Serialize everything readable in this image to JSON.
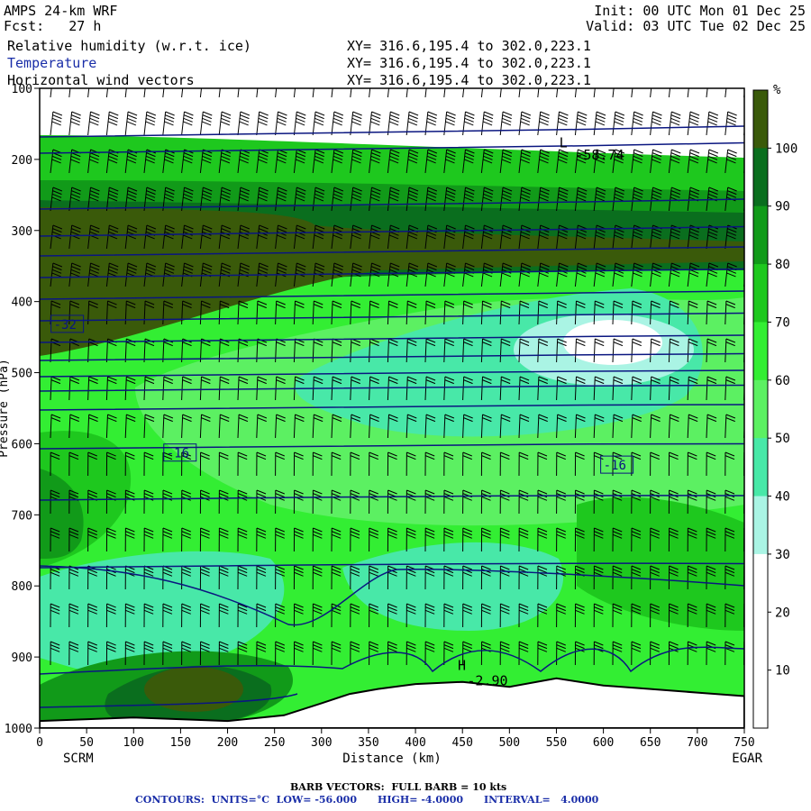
{
  "header": {
    "model": "AMPS 24-km WRF",
    "forecast": "Fcst:   27 h",
    "init": "Init: 00 UTC Mon 01 Dec 25",
    "valid": "Valid: 03 UTC Tue 02 Dec 25",
    "field1": "Relative humidity (w.r.t. ice)",
    "field2": "Temperature",
    "field3": "Horizontal wind vectors",
    "xy1": "XY= 316.6,195.4 to 302.0,223.1",
    "xy2": "XY= 316.6,195.4 to 302.0,223.1",
    "xy3": "XY= 316.6,195.4 to 302.0,223.1"
  },
  "footer": {
    "barb": "BARB VECTORS:  FULL BARB = 10 kts",
    "contours": "CONTOURS:  UNITS=°C  LOW= -56.000      HIGH= -4.0000      INTERVAL=   4.0000"
  },
  "chart_data": {
    "type": "heatmap",
    "xlabel": "Distance (km)",
    "ylabel": "Pressure (hPa)",
    "xlim": [
      0,
      750
    ],
    "ylim": [
      1000,
      100
    ],
    "x_ticks": [
      0,
      50,
      100,
      150,
      200,
      250,
      300,
      350,
      400,
      450,
      500,
      550,
      600,
      650,
      700,
      750
    ],
    "y_ticks": [
      100,
      200,
      300,
      400,
      500,
      600,
      700,
      800,
      900,
      1000
    ],
    "endpoint_labels": {
      "left": "SCRM",
      "right": "EGAR"
    },
    "colorbar": {
      "unit": "%",
      "levels": [
        100,
        90,
        80,
        70,
        60,
        50,
        40,
        30,
        20,
        10
      ],
      "colors": [
        "#3a5a0a",
        "#0a6e1e",
        "#119a19",
        "#1ec81e",
        "#33ee33",
        "#5cf062",
        "#48e8a8",
        "#aaf4e4",
        "#ffffff",
        "#ffffff",
        "#ffffff"
      ]
    },
    "temperature_contour_labels": [
      {
        "text": "-32",
        "x": 15,
        "p": 432
      },
      {
        "text": "-16",
        "x": 135,
        "p": 613
      },
      {
        "text": "-16",
        "x": 600,
        "p": 630
      }
    ],
    "annotations": [
      {
        "text": "L",
        "x": 553,
        "p": 183
      },
      {
        "text": "-58.74",
        "x": 570,
        "p": 200
      },
      {
        "text": "H",
        "x": 445,
        "p": 918
      },
      {
        "text": "-2.90",
        "x": 455,
        "p": 940
      }
    ],
    "terrain": [
      [
        0,
        990
      ],
      [
        100,
        985
      ],
      [
        200,
        990
      ],
      [
        260,
        982
      ],
      [
        300,
        965
      ],
      [
        330,
        952
      ],
      [
        360,
        945
      ],
      [
        400,
        938
      ],
      [
        450,
        935
      ],
      [
        500,
        942
      ],
      [
        550,
        930
      ],
      [
        600,
        940
      ],
      [
        650,
        945
      ],
      [
        700,
        950
      ],
      [
        750,
        955
      ]
    ]
  }
}
